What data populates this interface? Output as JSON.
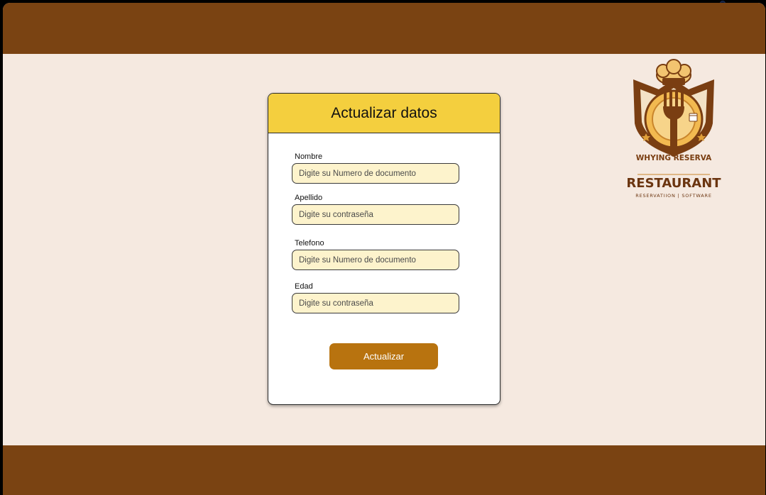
{
  "form": {
    "title": "Actualizar datos",
    "fields": [
      {
        "label": "Nombre",
        "placeholder": "Digite su Numero de documento"
      },
      {
        "label": "Apellido",
        "placeholder": "Digite su contraseña"
      },
      {
        "label": "Telefono",
        "placeholder": "Digite su Numero de documento"
      },
      {
        "label": "Edad",
        "placeholder": "Digite su contraseña"
      }
    ],
    "submit_label": "Actualizar"
  },
  "logo": {
    "arc_text": "WHYING RESERVA",
    "name": "RESTAURANT",
    "tagline": "RESERVATIION | SOFTWARE",
    "icon": "chef-fork-crest-icon"
  },
  "colors": {
    "frame": "#7A4312",
    "background": "#F5E9E0",
    "header": "#F4CF3E",
    "input": "#FDF3CC",
    "button": "#B8730F"
  }
}
